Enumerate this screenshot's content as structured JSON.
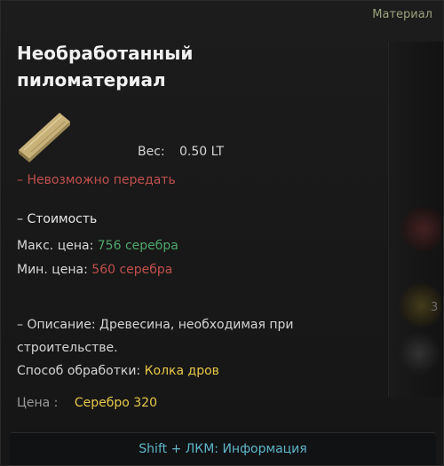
{
  "tooltip": {
    "category": "Материал",
    "title": "Необработанный пиломатериал",
    "item_icon": "lumber-plank-icon",
    "weight_label": "Вес:",
    "weight_value": "0.50 LT",
    "restriction": "– Невозможно передать",
    "cost_header": "– Стоимость",
    "max_price_label": "Макс. цена:",
    "max_price_value": "756 серебра",
    "min_price_label": "Мин. цена:",
    "min_price_value": "560 серебра",
    "description_line1": "– Описание: Древесина, необходимая при",
    "description_line2": "строительстве.",
    "processing_label": "Способ обработки:",
    "processing_value": "Колка дров",
    "price_label": "Цена :",
    "price_value": "Серебро 320",
    "footer_hint": "Shift + ЛКМ: Информация"
  },
  "background": {
    "slot_count_text": "3"
  },
  "colors": {
    "category": "#9aa37c",
    "positive": "#4fa86b",
    "negative": "#c0504d",
    "highlight": "#e7c84a",
    "hint": "#5fb6c9"
  }
}
